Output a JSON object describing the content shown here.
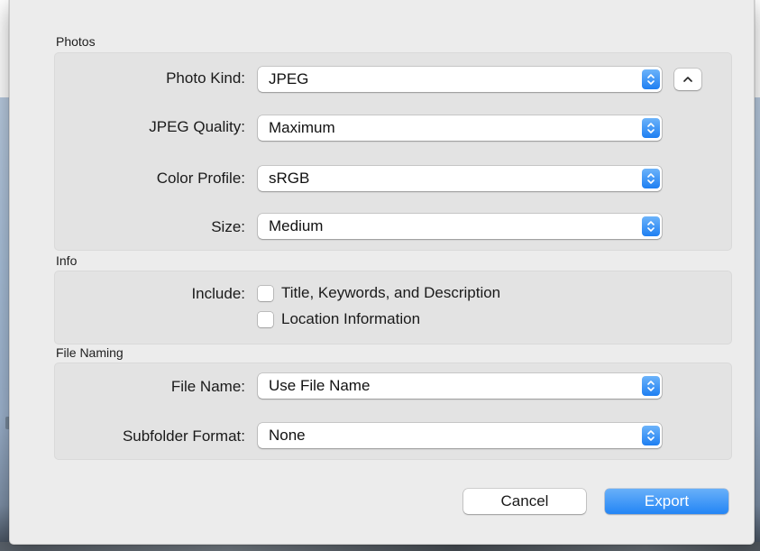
{
  "sections": {
    "photos": {
      "label": "Photos",
      "rows": [
        {
          "label": "Photo Kind:",
          "value": "JPEG"
        },
        {
          "label": "JPEG Quality:",
          "value": "Maximum"
        },
        {
          "label": "Color Profile:",
          "value": "sRGB"
        },
        {
          "label": "Size:",
          "value": "Medium"
        }
      ]
    },
    "info": {
      "label": "Info",
      "include_label": "Include:",
      "checkboxes": [
        {
          "label": "Title, Keywords, and Description",
          "checked": false
        },
        {
          "label": "Location Information",
          "checked": false
        }
      ]
    },
    "file_naming": {
      "label": "File Naming",
      "rows": [
        {
          "label": "File Name:",
          "value": "Use File Name"
        },
        {
          "label": "Subfolder Format:",
          "value": "None"
        }
      ]
    }
  },
  "buttons": {
    "cancel": "Cancel",
    "export": "Export"
  },
  "colors": {
    "accent": "#2385f5",
    "dialog_bg": "#ececec",
    "group_bg": "#e3e3e3"
  },
  "icons": {
    "stepper": "up-down-chevron-icon",
    "collapse": "chevron-up-icon"
  }
}
